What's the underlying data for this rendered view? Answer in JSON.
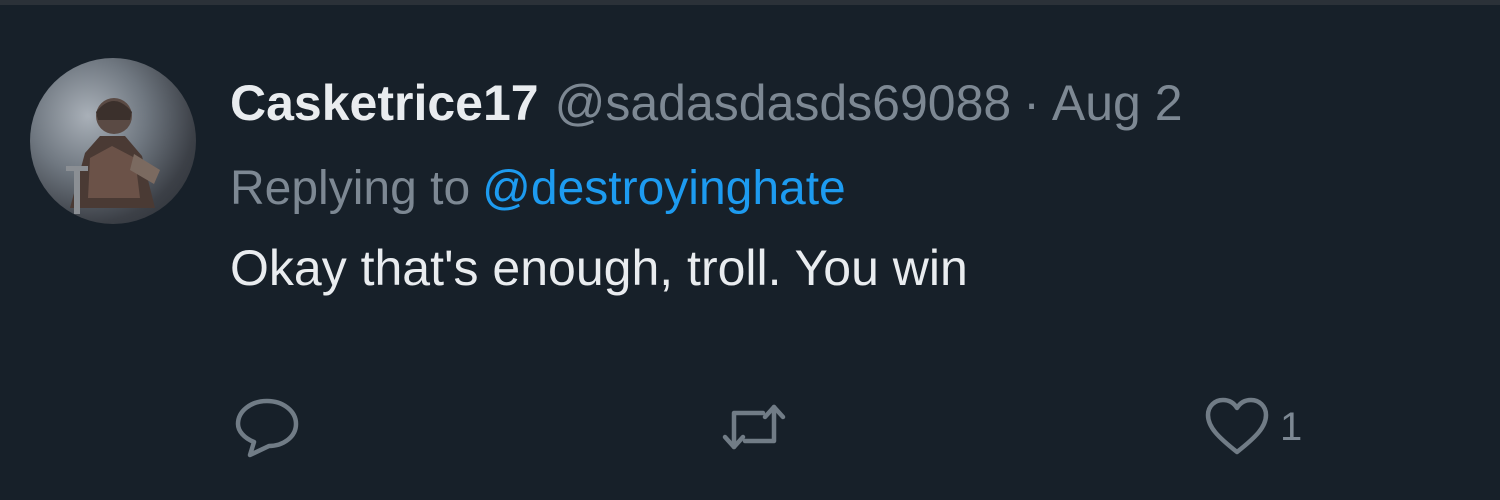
{
  "tweet": {
    "display_name": "Casketrice17",
    "handle": "@sadasdasds69088",
    "separator": "·",
    "date": "Aug 2",
    "reply_prefix": "Replying to",
    "reply_to": "@destroyinghate",
    "text": "Okay that's enough, troll. You win"
  },
  "actions": {
    "reply_icon": "speech-bubble-icon",
    "retweet_icon": "retweet-arrows-icon",
    "like_icon": "heart-icon",
    "like_count": "1"
  },
  "colors": {
    "background": "#172029",
    "primary_text": "#e9ecef",
    "secondary_text": "#7d8893",
    "link": "#1d9bf0"
  }
}
